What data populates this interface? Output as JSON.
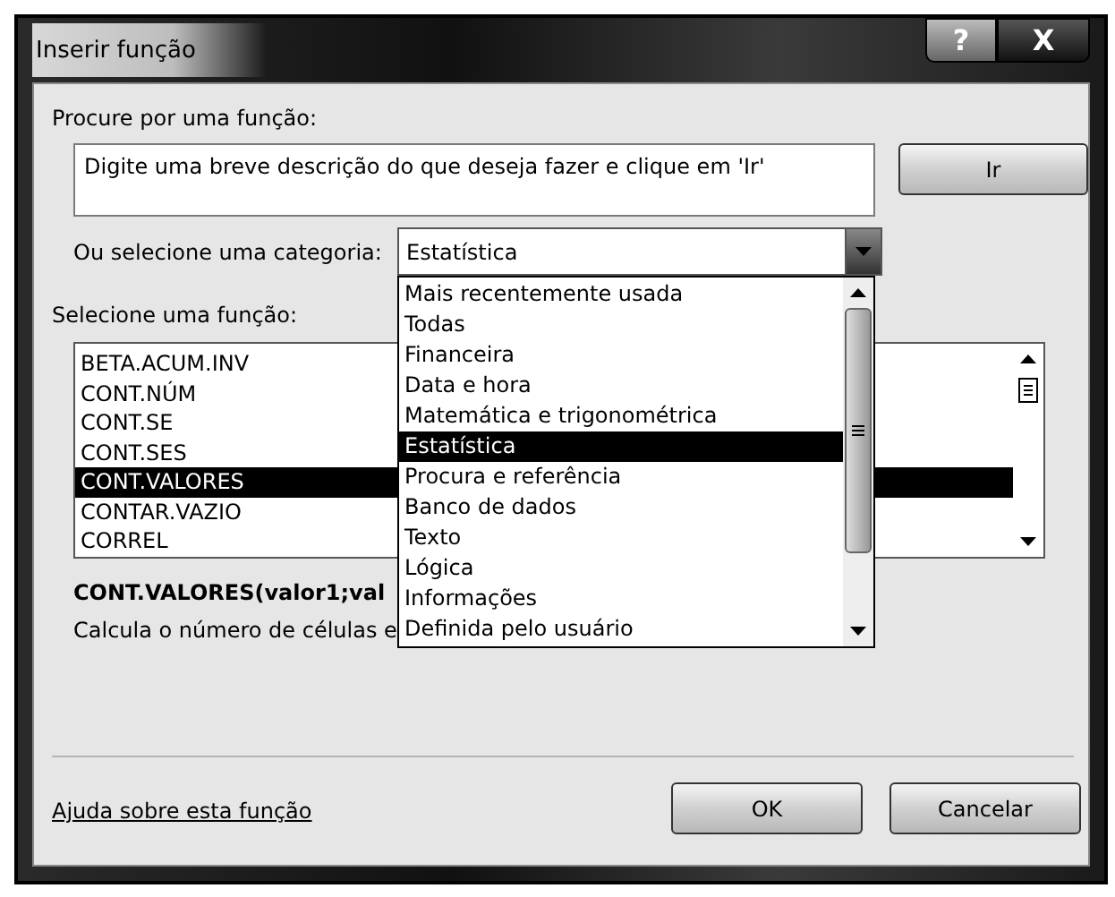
{
  "window": {
    "title": "Inserir função",
    "help_button": "?",
    "close_button": "X"
  },
  "search": {
    "label": "Procure por uma função:",
    "value": "Digite uma breve descrição do que deseja fazer e clique em 'Ir'",
    "button": "Ir"
  },
  "category": {
    "label": "Ou selecione uma categoria:",
    "value": "Estatística",
    "expanded": true,
    "options": [
      {
        "label": "Mais recentemente usada",
        "selected": false
      },
      {
        "label": "Todas",
        "selected": false
      },
      {
        "label": "Financeira",
        "selected": false
      },
      {
        "label": "Data e hora",
        "selected": false
      },
      {
        "label": "Matemática e trigonométrica",
        "selected": false
      },
      {
        "label": "Estatística",
        "selected": true
      },
      {
        "label": "Procura e referência",
        "selected": false
      },
      {
        "label": "Banco de dados",
        "selected": false
      },
      {
        "label": "Texto",
        "selected": false
      },
      {
        "label": "Lógica",
        "selected": false
      },
      {
        "label": "Informações",
        "selected": false
      },
      {
        "label": "Definida pelo usuário",
        "selected": false
      }
    ]
  },
  "functions": {
    "label": "Selecione uma função:",
    "items": [
      {
        "label": "BETA.ACUM.INV",
        "selected": false
      },
      {
        "label": "CONT.NÚM",
        "selected": false
      },
      {
        "label": "CONT.SE",
        "selected": false
      },
      {
        "label": "CONT.SES",
        "selected": false
      },
      {
        "label": "CONT.VALORES",
        "selected": true
      },
      {
        "label": "CONTAR.VAZIO",
        "selected": false
      },
      {
        "label": "CORREL",
        "selected": false
      }
    ]
  },
  "signature": "CONT.VALORES(valor1;val",
  "description": "Calcula o número de células e",
  "help_link": "Ajuda sobre esta função",
  "buttons": [
    "OK",
    "Cancelar"
  ]
}
